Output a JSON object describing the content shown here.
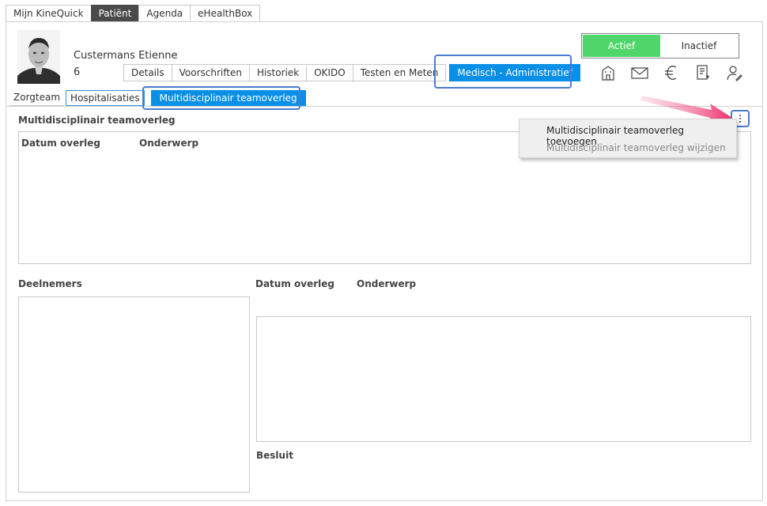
{
  "top_tabs": [
    "Mijn KineQuick",
    "Patiënt",
    "Agenda",
    "eHealthBox"
  ],
  "patient": {
    "name": "Custermans Etienne",
    "number": "6"
  },
  "patient_tabs": [
    "Details",
    "Voorschriften",
    "Historiek",
    "OKIDO",
    "Testen en Meten",
    "Medisch - Administratief"
  ],
  "status": {
    "active_label": "Actief",
    "inactive_label": "Inactief",
    "active_color": "#4fd66a"
  },
  "header_icons": [
    "building-icon",
    "mail-icon",
    "euro-icon",
    "document-icon",
    "user-edit-icon"
  ],
  "section_tabs": [
    "Zorgteam",
    "Hospitalisaties",
    "Multidisciplinair teamoverleg"
  ],
  "list_section": {
    "title": "Multidisciplinair teamoverleg",
    "columns": [
      "Datum overleg",
      "Onderwerp"
    ]
  },
  "context_menu": {
    "items": [
      {
        "label": "Multidisciplinair teamoverleg toevoegen",
        "enabled": true
      },
      {
        "label": "Multidisciplinair teamoverleg wijzigen",
        "enabled": false
      }
    ]
  },
  "detail": {
    "participants_title": "Deelnemers",
    "date_label": "Datum overleg",
    "subject_label": "Onderwerp",
    "decision_label": "Besluit"
  },
  "accent_color": "#0a8fe6",
  "highlight_color": "#4a7bd0",
  "arrow_color": "#ec2f6b"
}
